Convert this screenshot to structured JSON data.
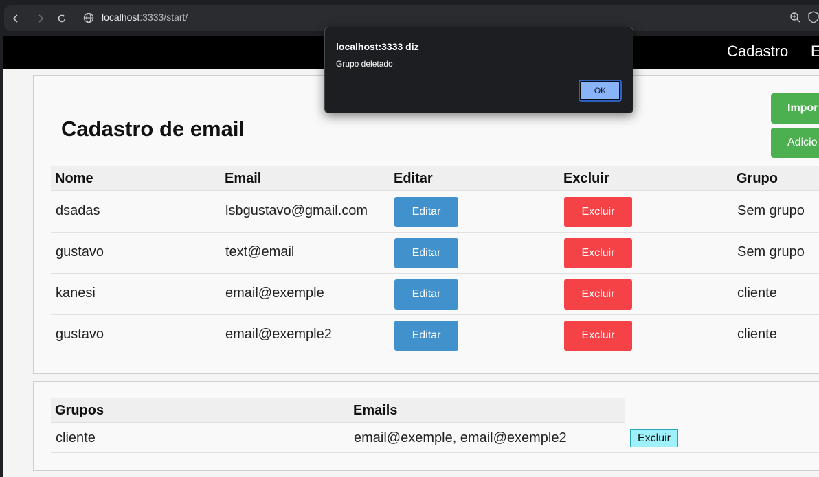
{
  "browser": {
    "url_host": "localhost",
    "url_rest": ":3333/start/"
  },
  "nav": {
    "link1": "Cadastro",
    "link2": "E"
  },
  "page": {
    "title": "Cadastro de email",
    "import_button": "Impor",
    "add_button": "Adicio"
  },
  "emails_table": {
    "headers": [
      "Nome",
      "Email",
      "Editar",
      "Excluir",
      "Grupo"
    ],
    "edit_label": "Editar",
    "delete_label": "Excluir",
    "rows": [
      {
        "nome": "dsadas",
        "email": "lsbgustavo@gmail.com",
        "grupo": "Sem grupo"
      },
      {
        "nome": "gustavo",
        "email": "text@email",
        "grupo": "Sem grupo"
      },
      {
        "nome": "kanesi",
        "email": "email@exemple",
        "grupo": "cliente"
      },
      {
        "nome": "gustavo",
        "email": "email@exemple2",
        "grupo": "cliente"
      }
    ]
  },
  "groups_table": {
    "headers": [
      "Grupos",
      "Emails"
    ],
    "rows": [
      {
        "grupo": "cliente",
        "emails": "email@exemple, email@exemple2",
        "delete_label": "Excluir"
      }
    ]
  },
  "dialog": {
    "title": "localhost:3333 diz",
    "message": "Grupo deletado",
    "ok_label": "OK"
  }
}
